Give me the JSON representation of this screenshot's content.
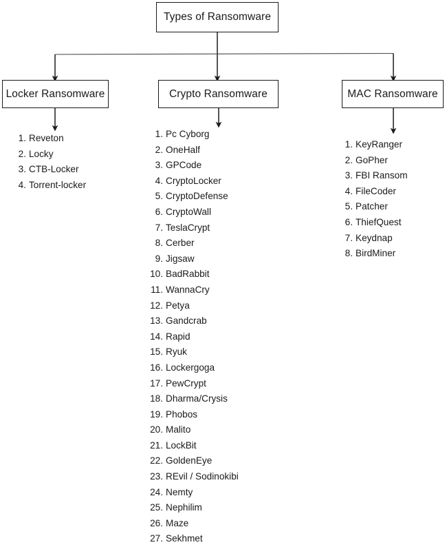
{
  "diagram": {
    "title": "Types of Ransomware",
    "root": {
      "label": "Types of Ransomware"
    },
    "categories": [
      {
        "id": "locker",
        "label": "Locker Ransomware",
        "items": [
          "Reveton",
          "Locky",
          "CTB-Locker",
          "Torrent-locker"
        ]
      },
      {
        "id": "crypto",
        "label": "Crypto Ransomware",
        "items": [
          "Pc Cyborg",
          "OneHalf",
          "GPCode",
          "CryptoLocker",
          "CryptoDefense",
          "CryptoWall",
          "TeslaCrypt",
          "Cerber",
          "Jigsaw",
          "BadRabbit",
          "WannaCry",
          "Petya",
          "Gandcrab",
          "Rapid",
          "Ryuk",
          "Lockergoga",
          "PewCrypt",
          "Dharma/Crysis",
          "Phobos",
          "Malito",
          "LockBit",
          "GoldenEye",
          "REvil / Sodinokibi",
          "Nemty",
          "Nephilim",
          "Maze",
          "Sekhmet"
        ]
      },
      {
        "id": "mac",
        "label": "MAC Ransomware",
        "items": [
          "KeyRanger",
          "GoPher",
          "FBI Ransom",
          "FileCoder",
          "Patcher",
          "ThiefQuest",
          "Keydnap",
          "BirdMiner"
        ]
      }
    ],
    "style": {
      "line_color": "#1a1a1a",
      "box_border_color": "#1a1a1a",
      "background": "#ffffff",
      "text_color": "#1a1a1a"
    }
  }
}
